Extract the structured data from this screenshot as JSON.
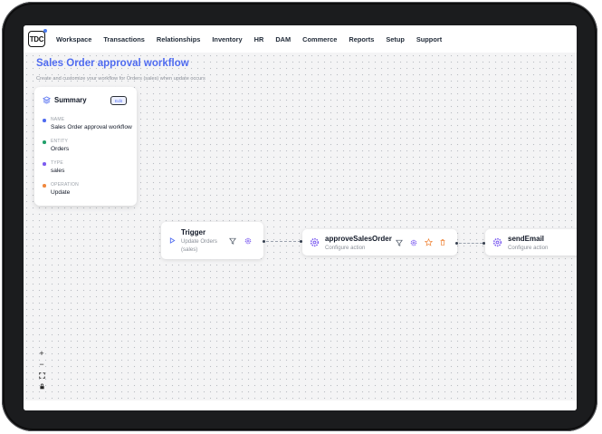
{
  "nav": {
    "logo_text": "TDC",
    "items": [
      "Workspace",
      "Transactions",
      "Relationships",
      "Inventory",
      "HR",
      "DAM",
      "Commerce",
      "Reports",
      "Setup",
      "Support"
    ]
  },
  "page": {
    "title": "Sales Order approval workflow",
    "subtitle": "Create and customize your workflow for Orders (sales) when update occurs"
  },
  "summary": {
    "title": "Summary",
    "edit_label": "Edit",
    "fields": [
      {
        "label": "NAME",
        "value": "Sales Order approval workflow",
        "color": "#4f6bf0"
      },
      {
        "label": "ENTITY",
        "value": "Orders",
        "color": "#22a06b"
      },
      {
        "label": "TYPE",
        "value": "sales",
        "color": "#7c5cf0"
      },
      {
        "label": "OPERATION",
        "value": "Update",
        "color": "#f0883e"
      }
    ]
  },
  "nodes": {
    "trigger": {
      "title": "Trigger",
      "subtitle_line1": "Update Orders",
      "subtitle_line2": "(sales)"
    },
    "approve": {
      "title": "approveSalesOrder",
      "subtitle": "Configure action"
    },
    "email": {
      "title": "sendEmail",
      "subtitle": "Configure action"
    }
  },
  "zoom": {
    "zoom_in": "+",
    "zoom_out": "−",
    "fit": "⛶",
    "lock": "🔒"
  },
  "colors": {
    "accent": "#4f6bf0",
    "action_icon": "#7c5cf0",
    "warning": "#f0883e"
  }
}
